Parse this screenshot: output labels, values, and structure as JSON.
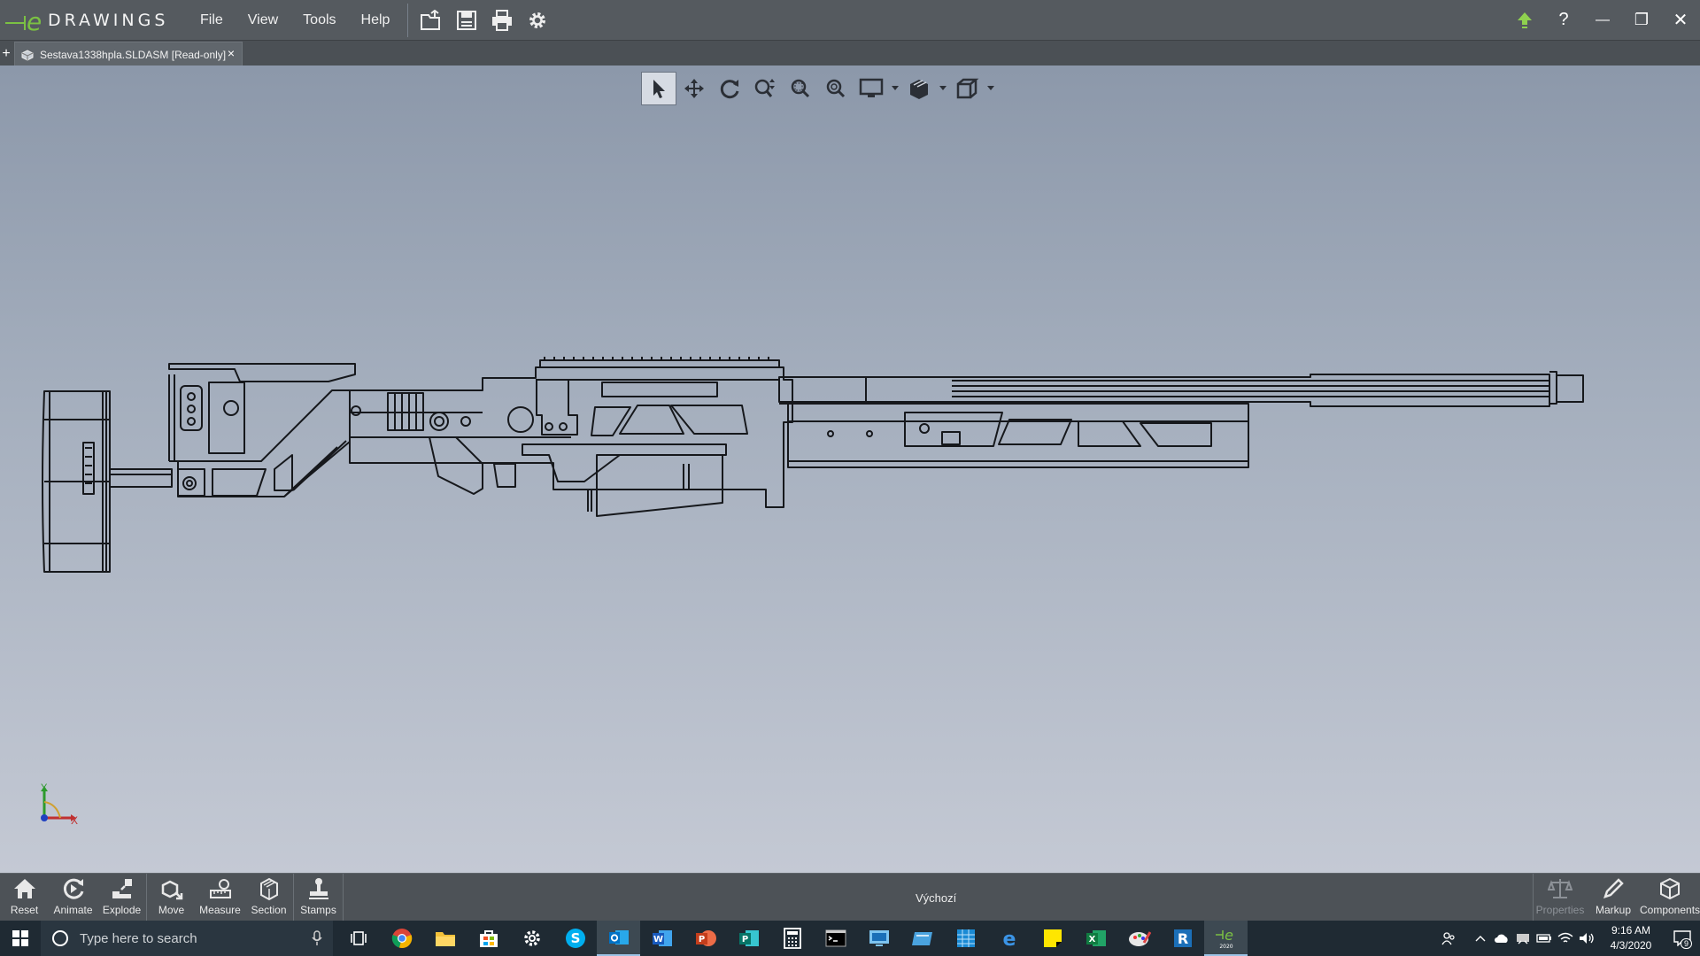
{
  "app": {
    "logo_text": "DRAWINGS",
    "menu": [
      "File",
      "View",
      "Tools",
      "Help"
    ]
  },
  "tab": {
    "title": "Sestava1338hpla.SLDASM [Read-only]",
    "close_glyph": "×",
    "new_tab_glyph": "+"
  },
  "window_controls": {
    "minimize": "—",
    "restore": "❐",
    "close": "✕",
    "help": "?"
  },
  "triad": {
    "x_label": "X",
    "y_label": "Y"
  },
  "bottom_toolbar": {
    "left": [
      "Reset",
      "Animate",
      "Explode",
      "Move",
      "Measure",
      "Section",
      "Stamps"
    ],
    "configuration": "Výchozí",
    "right": [
      "Properties",
      "Markup",
      "Components"
    ]
  },
  "taskbar": {
    "search_placeholder": "Type here to search",
    "time": "9:16 AM",
    "date": "4/3/2020",
    "notification_count": "9",
    "active_app_badge": "2020"
  },
  "colors": {
    "titlebar": "#555a5f",
    "accent_green": "#7bc143",
    "viewport_top": "#8c98aa",
    "viewport_bottom": "#c4c9d4",
    "taskbar": "#1f2a33"
  }
}
